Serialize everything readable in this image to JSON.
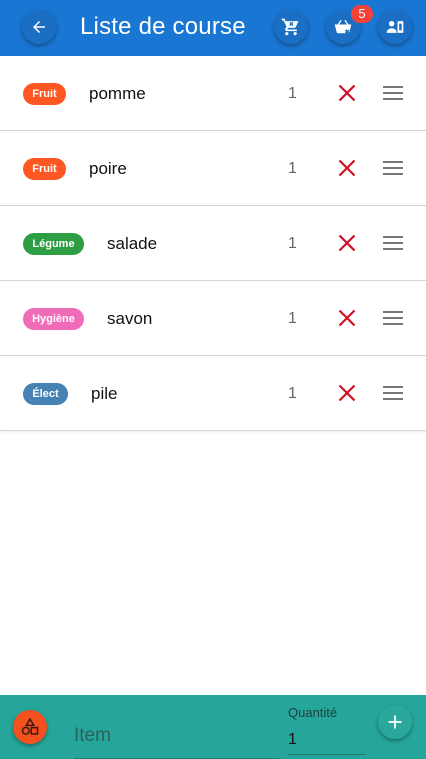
{
  "header": {
    "title": "Liste de course",
    "back_icon": "arrow-left-icon",
    "cart_icon": "cart-remove-icon",
    "basket_icon": "basket-remove-icon",
    "basket_badge": "5",
    "account_icon": "account-box-icon"
  },
  "items": [
    {
      "category": "Fruit",
      "category_color": "#ff5722",
      "name": "pomme",
      "quantity": "1"
    },
    {
      "category": "Fruit",
      "category_color": "#ff5722",
      "name": "poire",
      "quantity": "1"
    },
    {
      "category": "Légume",
      "category_color": "#2e9e44",
      "name": "salade",
      "quantity": "1"
    },
    {
      "category": "Hygiène",
      "category_color": "#f06bb8",
      "name": "savon",
      "quantity": "1"
    },
    {
      "category": "Élect",
      "category_color": "#4682b4",
      "name": "pile",
      "quantity": "1"
    }
  ],
  "footer": {
    "item_placeholder": "Item",
    "quantity_label": "Quantité",
    "quantity_value": "1",
    "category_icon": "shapes-icon",
    "add_icon": "plus-icon"
  },
  "colors": {
    "header": "#1976d2",
    "footer": "#26a69a",
    "delete": "#cc1122",
    "badge": "#f44336"
  }
}
